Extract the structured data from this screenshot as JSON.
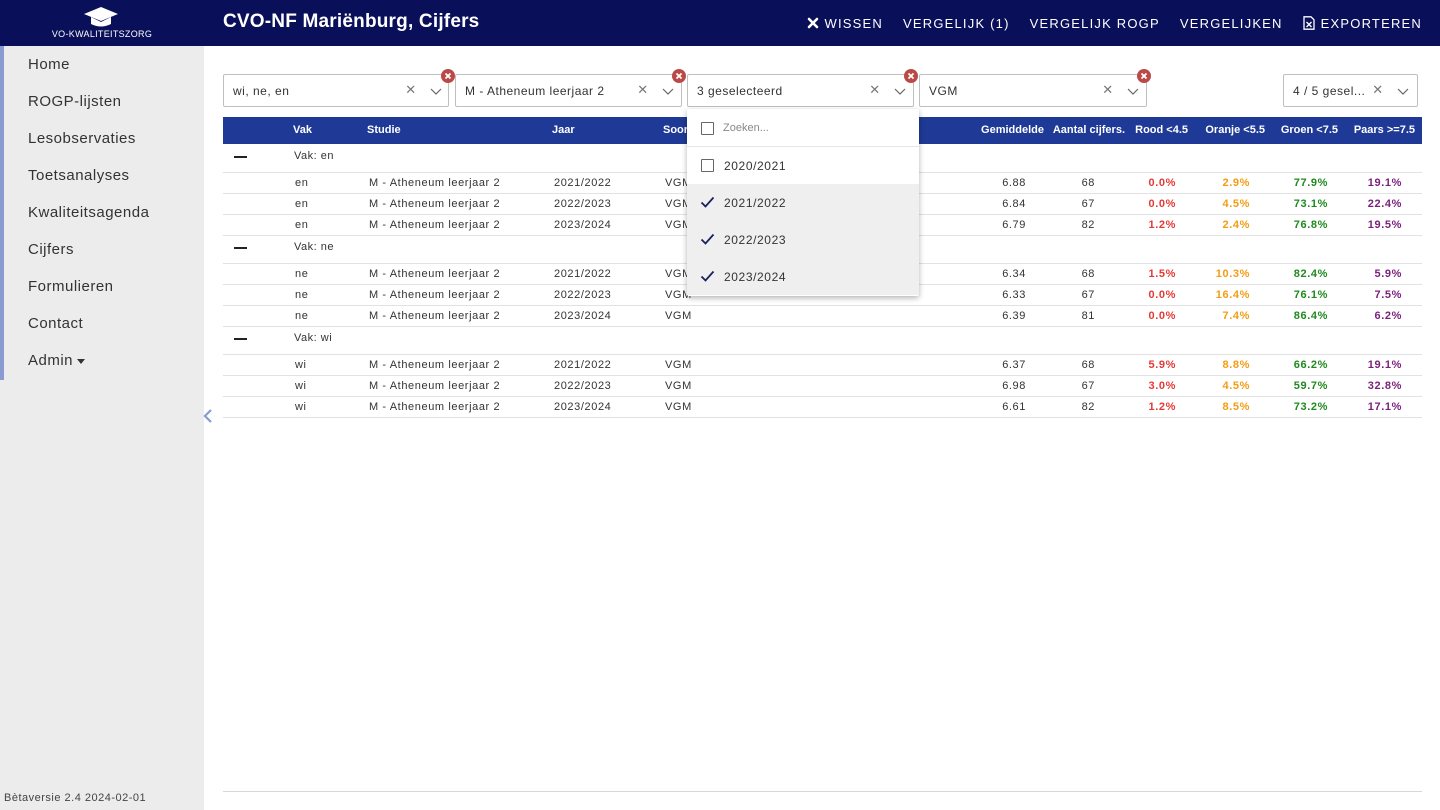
{
  "app": {
    "logo_text": "VO-KWALITEITSZORG",
    "page_title": "CVO-NF Mariënburg, Cijfers",
    "version": "Bètaversie 2.4 2024-02-01"
  },
  "top_actions": [
    {
      "label": "WISSEN",
      "icon": "close-icon"
    },
    {
      "label": "VERGELIJK (1)"
    },
    {
      "label": "VERGELIJK ROGP"
    },
    {
      "label": "VERGELIJKEN"
    },
    {
      "label": "EXPORTEREN",
      "icon": "excel-icon"
    }
  ],
  "sidebar": {
    "items": [
      {
        "label": "Home"
      },
      {
        "label": "ROGP-lijsten"
      },
      {
        "label": "Lesobservaties"
      },
      {
        "label": "Toetsanalyses"
      },
      {
        "label": "Kwaliteitsagenda"
      },
      {
        "label": "Cijfers"
      },
      {
        "label": "Formulieren"
      },
      {
        "label": "Contact"
      },
      {
        "label": "Admin"
      }
    ]
  },
  "filters": [
    {
      "value": "wi, ne, en"
    },
    {
      "value": "M - Atheneum leerjaar 2"
    },
    {
      "value": "3 geselecteerd"
    },
    {
      "value": "VGM"
    },
    {
      "value": "4 / 5 gesel..."
    }
  ],
  "dropdown": {
    "search_placeholder": "Zoeken...",
    "options": [
      {
        "label": "2020/2021",
        "checked": false
      },
      {
        "label": "2021/2022",
        "checked": true
      },
      {
        "label": "2022/2023",
        "checked": true
      },
      {
        "label": "2023/2024",
        "checked": true
      }
    ]
  },
  "table": {
    "columns": {
      "vak": "Vak",
      "studie": "Studie",
      "jaar": "Jaar",
      "soort": "Soort",
      "gemiddelde": "Gemiddelde",
      "aantal": "Aantal cijfers.",
      "rood": "Rood <4.5",
      "oranje": "Oranje <5.5",
      "groen": "Groen <7.5",
      "paars": "Paars >=7.5"
    },
    "groups": [
      {
        "label": "Vak: en",
        "rows": [
          {
            "vak": "en",
            "studie": "M - Atheneum leerjaar 2",
            "jaar": "2021/2022",
            "soort": "VGM",
            "gem": "6.88",
            "aantal": "68",
            "rood": "0.0%",
            "oranje": "2.9%",
            "groen": "77.9%",
            "paars": "19.1%"
          },
          {
            "vak": "en",
            "studie": "M - Atheneum leerjaar 2",
            "jaar": "2022/2023",
            "soort": "VGM",
            "gem": "6.84",
            "aantal": "67",
            "rood": "0.0%",
            "oranje": "4.5%",
            "groen": "73.1%",
            "paars": "22.4%"
          },
          {
            "vak": "en",
            "studie": "M - Atheneum leerjaar 2",
            "jaar": "2023/2024",
            "soort": "VGM",
            "gem": "6.79",
            "aantal": "82",
            "rood": "1.2%",
            "oranje": "2.4%",
            "groen": "76.8%",
            "paars": "19.5%"
          }
        ]
      },
      {
        "label": "Vak: ne",
        "rows": [
          {
            "vak": "ne",
            "studie": "M - Atheneum leerjaar 2",
            "jaar": "2021/2022",
            "soort": "VGM",
            "gem": "6.34",
            "aantal": "68",
            "rood": "1.5%",
            "oranje": "10.3%",
            "groen": "82.4%",
            "paars": "5.9%"
          },
          {
            "vak": "ne",
            "studie": "M - Atheneum leerjaar 2",
            "jaar": "2022/2023",
            "soort": "VGM",
            "gem": "6.33",
            "aantal": "67",
            "rood": "0.0%",
            "oranje": "16.4%",
            "groen": "76.1%",
            "paars": "7.5%"
          },
          {
            "vak": "ne",
            "studie": "M - Atheneum leerjaar 2",
            "jaar": "2023/2024",
            "soort": "VGM",
            "gem": "6.39",
            "aantal": "81",
            "rood": "0.0%",
            "oranje": "7.4%",
            "groen": "86.4%",
            "paars": "6.2%"
          }
        ]
      },
      {
        "label": "Vak: wi",
        "rows": [
          {
            "vak": "wi",
            "studie": "M - Atheneum leerjaar 2",
            "jaar": "2021/2022",
            "soort": "VGM",
            "gem": "6.37",
            "aantal": "68",
            "rood": "5.9%",
            "oranje": "8.8%",
            "groen": "66.2%",
            "paars": "19.1%"
          },
          {
            "vak": "wi",
            "studie": "M - Atheneum leerjaar 2",
            "jaar": "2022/2023",
            "soort": "VGM",
            "gem": "6.98",
            "aantal": "67",
            "rood": "3.0%",
            "oranje": "4.5%",
            "groen": "59.7%",
            "paars": "32.8%"
          },
          {
            "vak": "wi",
            "studie": "M - Atheneum leerjaar 2",
            "jaar": "2023/2024",
            "soort": "VGM",
            "gem": "6.61",
            "aantal": "82",
            "rood": "1.2%",
            "oranje": "8.5%",
            "groen": "73.2%",
            "paars": "17.1%"
          }
        ]
      }
    ]
  },
  "colors": {
    "topbar": "#0a0f5a",
    "table_header": "#1f3a96",
    "sidebar_bg": "#ececec",
    "sidebar_accent": "#8a9bd1",
    "rood": "#e53935",
    "oranje": "#f39c12",
    "groen": "#1e8a1e",
    "paars": "#7b1f7b",
    "remove_badge": "#b94a48"
  }
}
